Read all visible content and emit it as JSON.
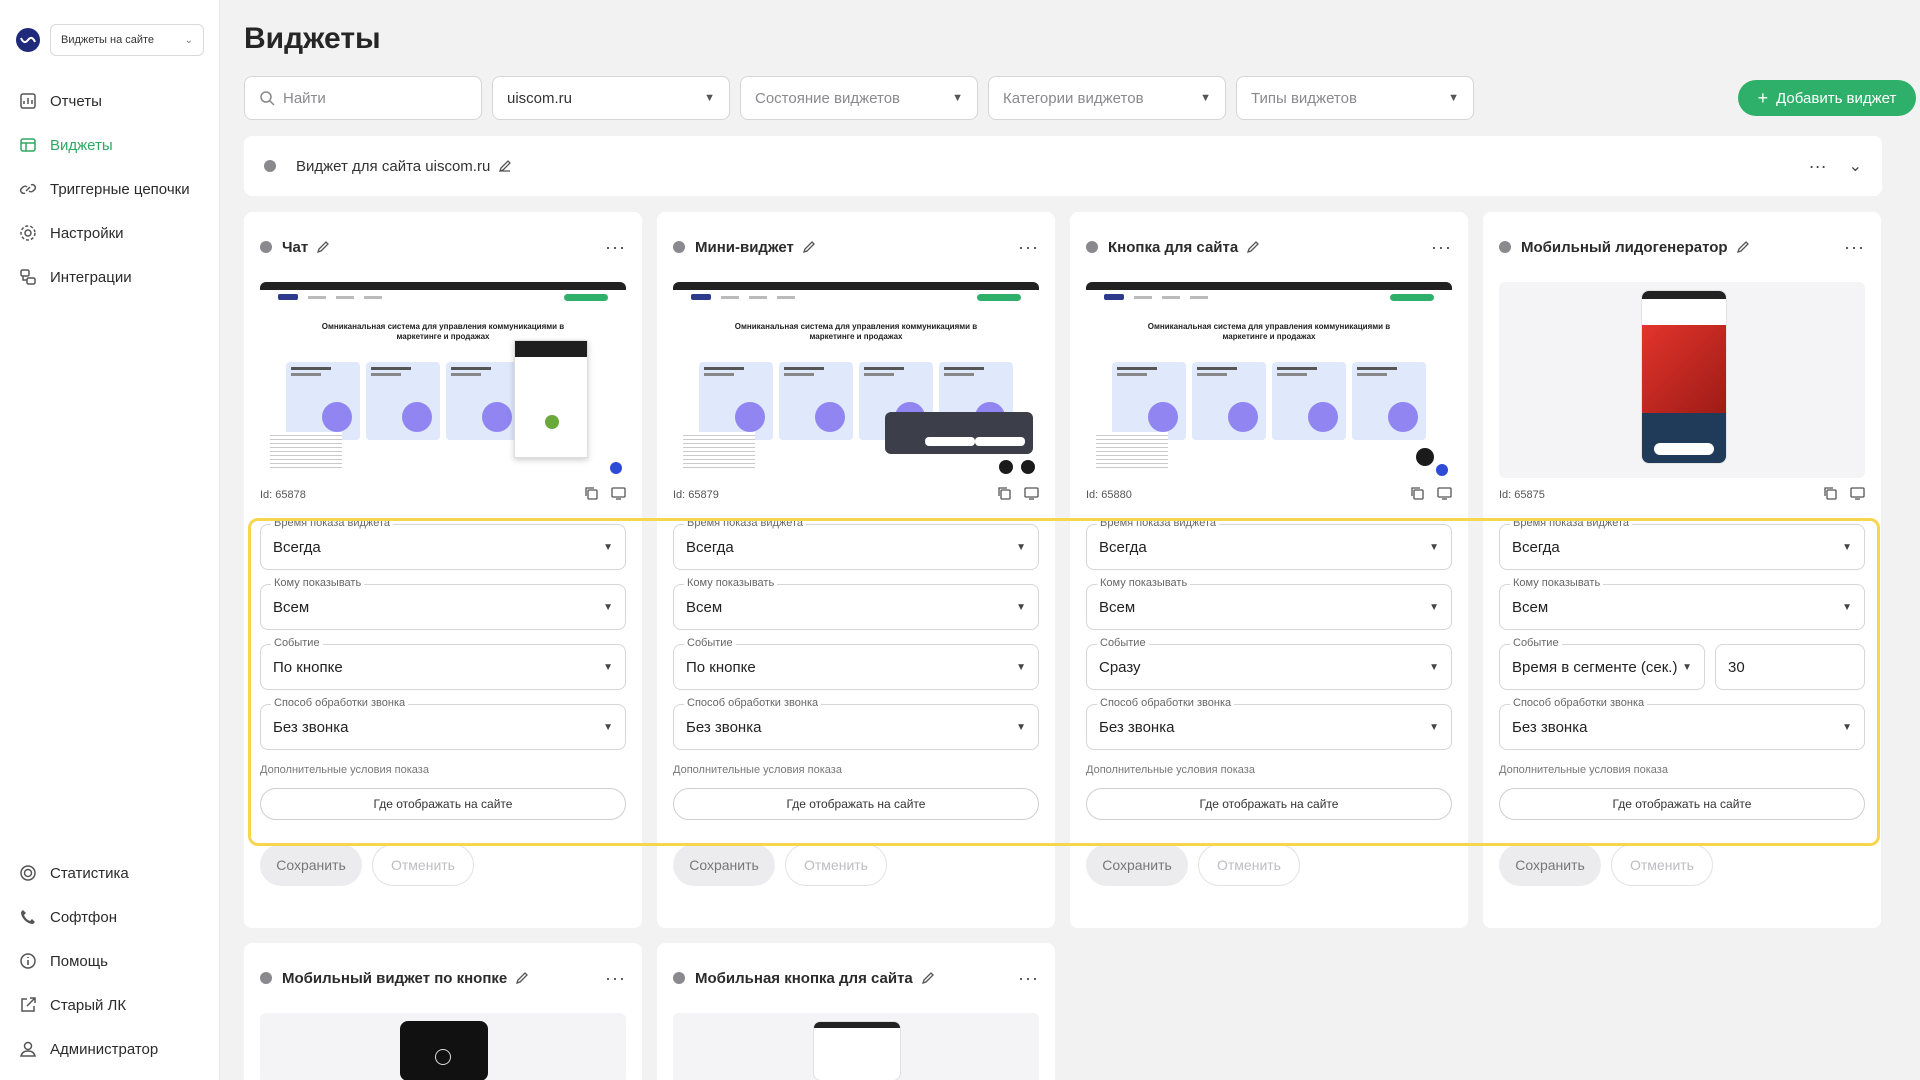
{
  "sidebar": {
    "workspace": "Виджеты на сайте",
    "top_items": [
      {
        "label": "Отчеты",
        "icon": "reports-icon"
      },
      {
        "label": "Виджеты",
        "icon": "widgets-icon",
        "active": true
      },
      {
        "label": "Триггерные цепочки",
        "icon": "link-icon"
      },
      {
        "label": "Настройки",
        "icon": "gear-icon"
      },
      {
        "label": "Интеграции",
        "icon": "integrations-icon"
      }
    ],
    "bottom_items": [
      {
        "label": "Статистика",
        "icon": "statistics-icon"
      },
      {
        "label": "Софтфон",
        "icon": "phone-icon"
      },
      {
        "label": "Помощь",
        "icon": "help-icon"
      },
      {
        "label": "Старый ЛК",
        "icon": "external-link-icon"
      },
      {
        "label": "Администратор",
        "icon": "user-icon"
      }
    ]
  },
  "header": {
    "title": "Виджеты",
    "search_placeholder": "Найти",
    "site_filter": "uiscom.ru",
    "state_filter": "Состояние виджетов",
    "category_filter": "Категории виджетов",
    "type_filter": "Типы виджетов",
    "add_button": "Добавить виджет"
  },
  "site": {
    "name": "Виджет для сайта uiscom.ru"
  },
  "labels": {
    "show_time": "Время показа виджета",
    "audience": "Кому показывать",
    "event": "Событие",
    "call_mode": "Способ обработки звонка",
    "extra": "Дополнительные условия показа",
    "where": "Где отображать на сайте",
    "save": "Сохранить",
    "cancel": "Отменить"
  },
  "widgets": [
    {
      "title": "Чат",
      "id": "Id: 65878",
      "show_time": "Всегда",
      "audience": "Всем",
      "event": "По кнопке",
      "call_mode": "Без звонка"
    },
    {
      "title": "Мини-виджет",
      "id": "Id: 65879",
      "show_time": "Всегда",
      "audience": "Всем",
      "event": "По кнопке",
      "call_mode": "Без звонка"
    },
    {
      "title": "Кнопка для сайта",
      "id": "Id: 65880",
      "show_time": "Всегда",
      "audience": "Всем",
      "event": "Сразу",
      "call_mode": "Без звонка"
    },
    {
      "title": "Мобильный лидогенератор",
      "id": "Id: 65875",
      "show_time": "Всегда",
      "audience": "Всем",
      "event": "Время в сегменте (сек.)",
      "event_value": "30",
      "call_mode": "Без звонка"
    },
    {
      "title": "Мобильный виджет по кнопке"
    },
    {
      "title": "Мобильная кнопка для сайта"
    }
  ],
  "preview": {
    "hero": "Омниканальная система для управления коммуникациями в маркетинге и продажах"
  },
  "colors": {
    "accent": "#2fb06a",
    "highlight": "#f5d64e"
  }
}
